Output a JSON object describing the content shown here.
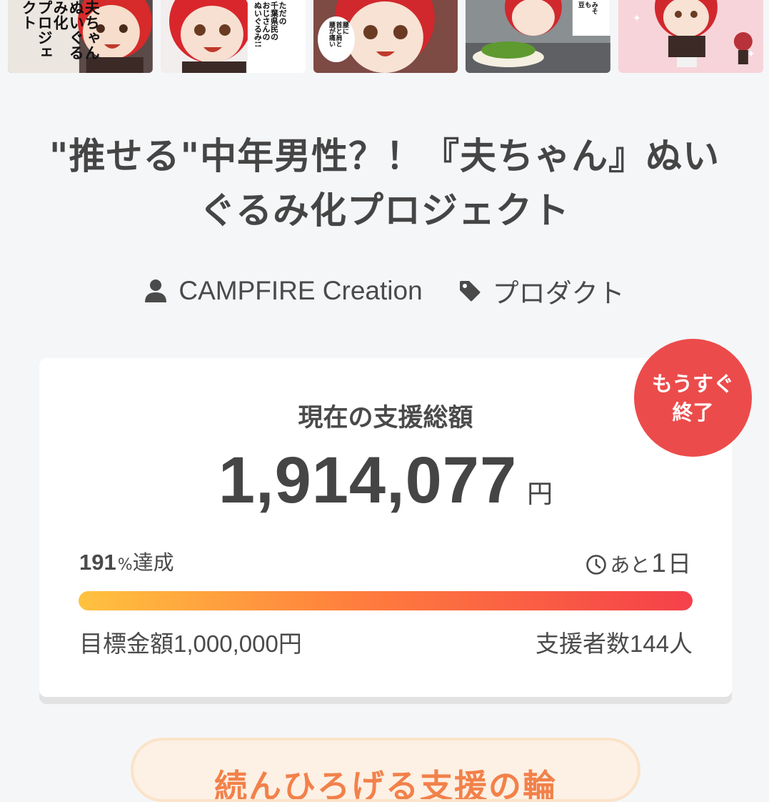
{
  "thumbnails": [
    {
      "alt": "夫ちゃん ぬいぐるみ化プロジェクト",
      "text": "夫ちゃん\nぬいぐるみ化\nプロジェクト"
    },
    {
      "alt": "ただの千葉県民のおじさんのぬいぐるみ!!",
      "text": "ただの\n千葉県民の\nおじさんの\nぬいぐるみ!!"
    },
    {
      "alt": "腰に首と肩が痛い",
      "text": "腰に\n首と肩と\n腰が痛い"
    },
    {
      "alt": "枝豆と夫ちゃん",
      "text": "みそ\nも\n豆"
    },
    {
      "alt": "ピンク背景の夫ちゃん",
      "text": ""
    }
  ],
  "project": {
    "title": "\"推せる\"中年男性？！『夫ちゃん』ぬいぐるみ化プロジェクト"
  },
  "meta": {
    "owner": "CAMPFIRE Creation",
    "category": "プロダクト"
  },
  "funding": {
    "badge_line1": "もうすぐ",
    "badge_line2": "終了",
    "label": "現在の支援総額",
    "amount": "1,914,077",
    "currency": "円",
    "percent": "191",
    "percent_sign": "%",
    "percent_suffix": "達成",
    "percent_fraction": 1.0,
    "remaining_prefix": "あと",
    "remaining_days": "1",
    "remaining_unit": "日",
    "goal_label": "目標金額",
    "goal_value": "1,000,000",
    "goal_unit": "円",
    "backers_label": "支援者数",
    "backers_value": "144",
    "backers_unit": "人"
  },
  "cta": {
    "label": "続んひろげる支援の輪"
  },
  "colors": {
    "accent_red": "#ec4b4b",
    "gradient_start": "#ffc23f",
    "gradient_end": "#f5404a",
    "text": "#454545",
    "background": "#f5f6f8"
  },
  "icons": {
    "owner": "person-icon",
    "category": "tag-icon",
    "remaining": "clock-icon"
  }
}
